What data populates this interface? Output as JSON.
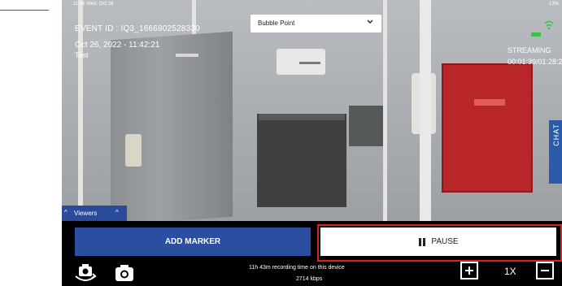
{
  "status_bar": {
    "time": "11:49  Wed, Oct 26",
    "right": "13%"
  },
  "event": {
    "id_text": "EVENT ID : IQ3_1666802528330",
    "datetime": "Oct 26, 2022 - 11:42:21",
    "subtitle": "Test"
  },
  "stream": {
    "status": "STREAMING",
    "timer": "00:01:39/01:28:21"
  },
  "dropdown": {
    "value": "Bubble Point"
  },
  "chat_tab": {
    "label": "CHAT"
  },
  "viewers": {
    "label": "Viewers"
  },
  "controls": {
    "add_marker_label": "ADD MARKER",
    "pause_label": "PAUSE",
    "recording_time": "11h 43m recording time on this device",
    "bitrate": "2714 kbps",
    "zoom_level": "1X"
  },
  "colors": {
    "accent_blue": "#2c4ea0",
    "highlight_red": "#e02020",
    "signal_green": "#39c449"
  },
  "icons": {
    "camera_switch": "camera-rotate-icon",
    "camera_snapshot": "camera-icon",
    "zoom_in": "plus-square-icon",
    "zoom_out": "minus-square-icon",
    "wifi": "wifi-icon"
  }
}
